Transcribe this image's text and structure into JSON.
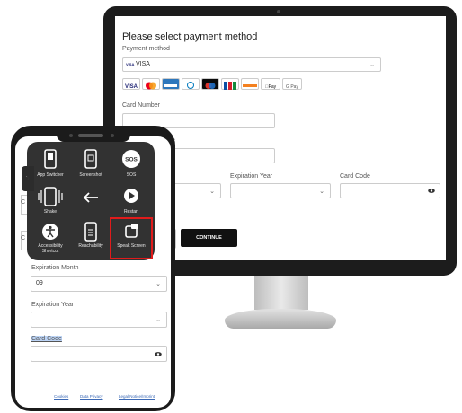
{
  "desktop": {
    "title": "Please select payment method",
    "payment_method_label": "Payment method",
    "selected_method": "VISA",
    "card_logos": [
      "VISA",
      "Mastercard",
      "AmEx",
      "Diners",
      "Maestro",
      "JCB",
      "Discover",
      "Apple Pay",
      "Google Pay"
    ],
    "card_logo_texts": {
      "apple_pay": "Pay",
      "google_pay": "G Pay",
      "visa_mini": "VISA"
    },
    "card_number_label": "Card Number",
    "name_label_partial": "ne",
    "expiration_month_label_partial": "h",
    "expiration_year_label": "Expiration Year",
    "card_code_label": "Card Code",
    "continue_button": "CONTINUE"
  },
  "phone": {
    "expiration_month_label": "Expiration Month",
    "expiration_month_value": "09",
    "expiration_year_label": "Expiration Year",
    "expiration_year_value": "",
    "card_code_label": "Card Code",
    "card_code_value": "",
    "footer_links": [
      "Cookies",
      "Data Privacy",
      "Legal Notice/Imprint"
    ],
    "partial_labels": [
      "C",
      "C"
    ]
  },
  "assistive_touch": {
    "items": [
      {
        "label": "App Switcher",
        "icon": "app-switcher-icon"
      },
      {
        "label": "Screenshot",
        "icon": "screenshot-icon"
      },
      {
        "label": "SOS",
        "icon": "sos-icon",
        "glyph": "SOS"
      },
      {
        "label": "Shake",
        "icon": "shake-icon"
      },
      {
        "label": "",
        "icon": "back-arrow-icon"
      },
      {
        "label": "Restart",
        "icon": "restart-icon"
      },
      {
        "label": "Accessibility Shortcut",
        "icon": "accessibility-icon"
      },
      {
        "label": "Reachability",
        "icon": "reachability-icon"
      },
      {
        "label": "Speak Screen",
        "icon": "speak-screen-icon"
      }
    ],
    "highlighted": "Speak Screen"
  },
  "colors": {
    "highlight": "#e01b1b",
    "menu_bg": "#2c2c2c",
    "button_bg": "#111111",
    "link": "#3a68b5"
  }
}
